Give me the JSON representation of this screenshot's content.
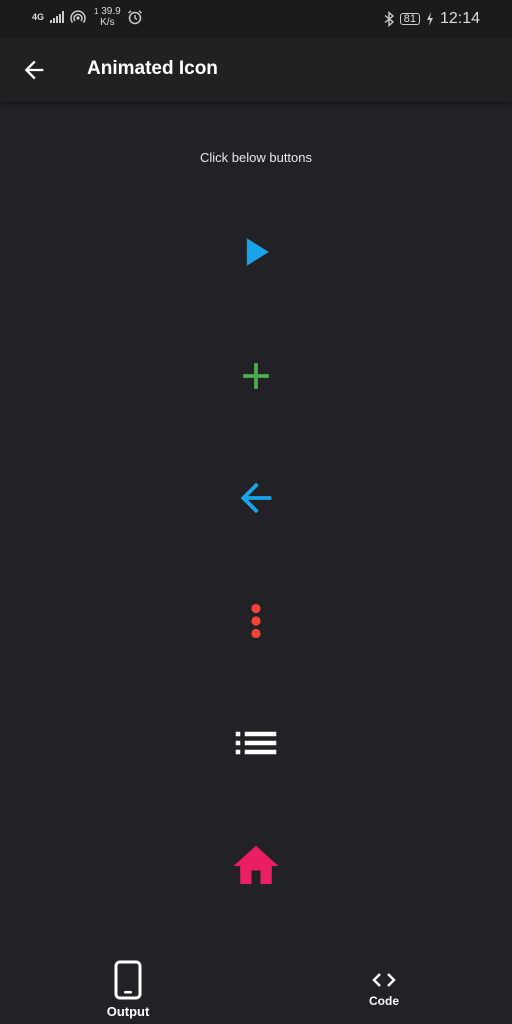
{
  "status_bar": {
    "signal": "4G",
    "speed_value": "39.9",
    "speed_unit": "K/s",
    "speed_superscript": "1",
    "battery": "81",
    "time": "12:14"
  },
  "app_bar": {
    "title": "Animated Icon"
  },
  "content": {
    "hint": "Click below buttons"
  },
  "icons": [
    {
      "name": "play-icon",
      "color": "#1aa3e8"
    },
    {
      "name": "add-icon",
      "color": "#4caf50"
    },
    {
      "name": "arrow-back-icon",
      "color": "#1aa3e8"
    },
    {
      "name": "more-vert-icon",
      "color": "#f44336"
    },
    {
      "name": "list-icon",
      "color": "#ffffff"
    },
    {
      "name": "home-icon",
      "color": "#e91e63"
    }
  ],
  "bottom_nav": {
    "output_label": "Output",
    "code_label": "Code"
  }
}
